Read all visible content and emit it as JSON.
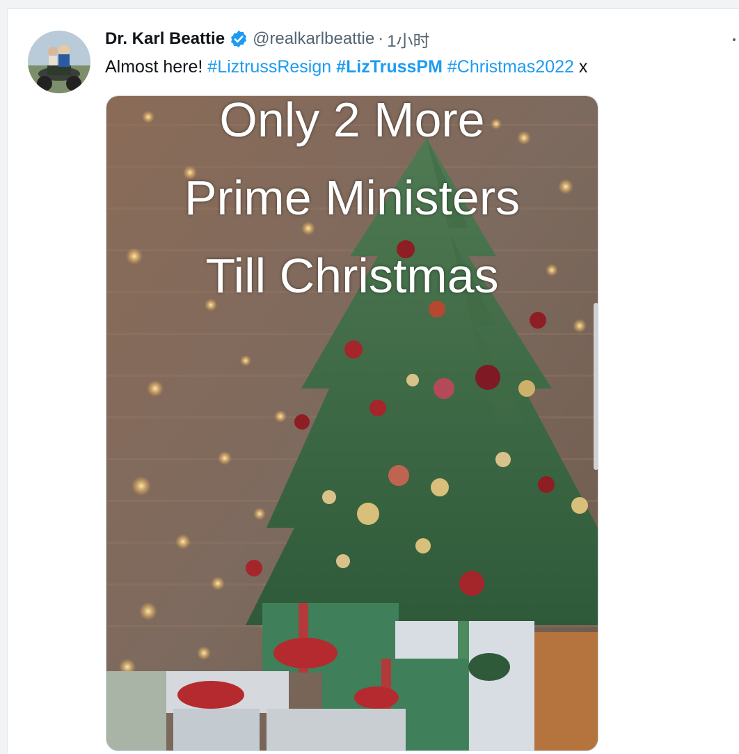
{
  "tweet": {
    "author_name": "Dr. Karl Beattie",
    "handle": "@realkarlbeattie",
    "separator": "·",
    "time": "1小时",
    "text_plain_start": "Almost here!",
    "hashtags": [
      {
        "text": "#LiztrussResign",
        "bold": false
      },
      {
        "text": "#LizTrussPM",
        "bold": true
      },
      {
        "text": "#Christmas2022",
        "bold": false
      }
    ],
    "text_plain_end": "x"
  },
  "media": {
    "caption_lines": [
      "Only 2 More",
      "Prime Ministers",
      "Till Christmas"
    ]
  },
  "colors": {
    "link": "#1d9bf0",
    "verified": "#1d9bf0",
    "text": "#0f1419",
    "secondary": "#536471"
  },
  "icons": {
    "verified": "verified-badge-icon",
    "more": "more-dots-icon"
  }
}
